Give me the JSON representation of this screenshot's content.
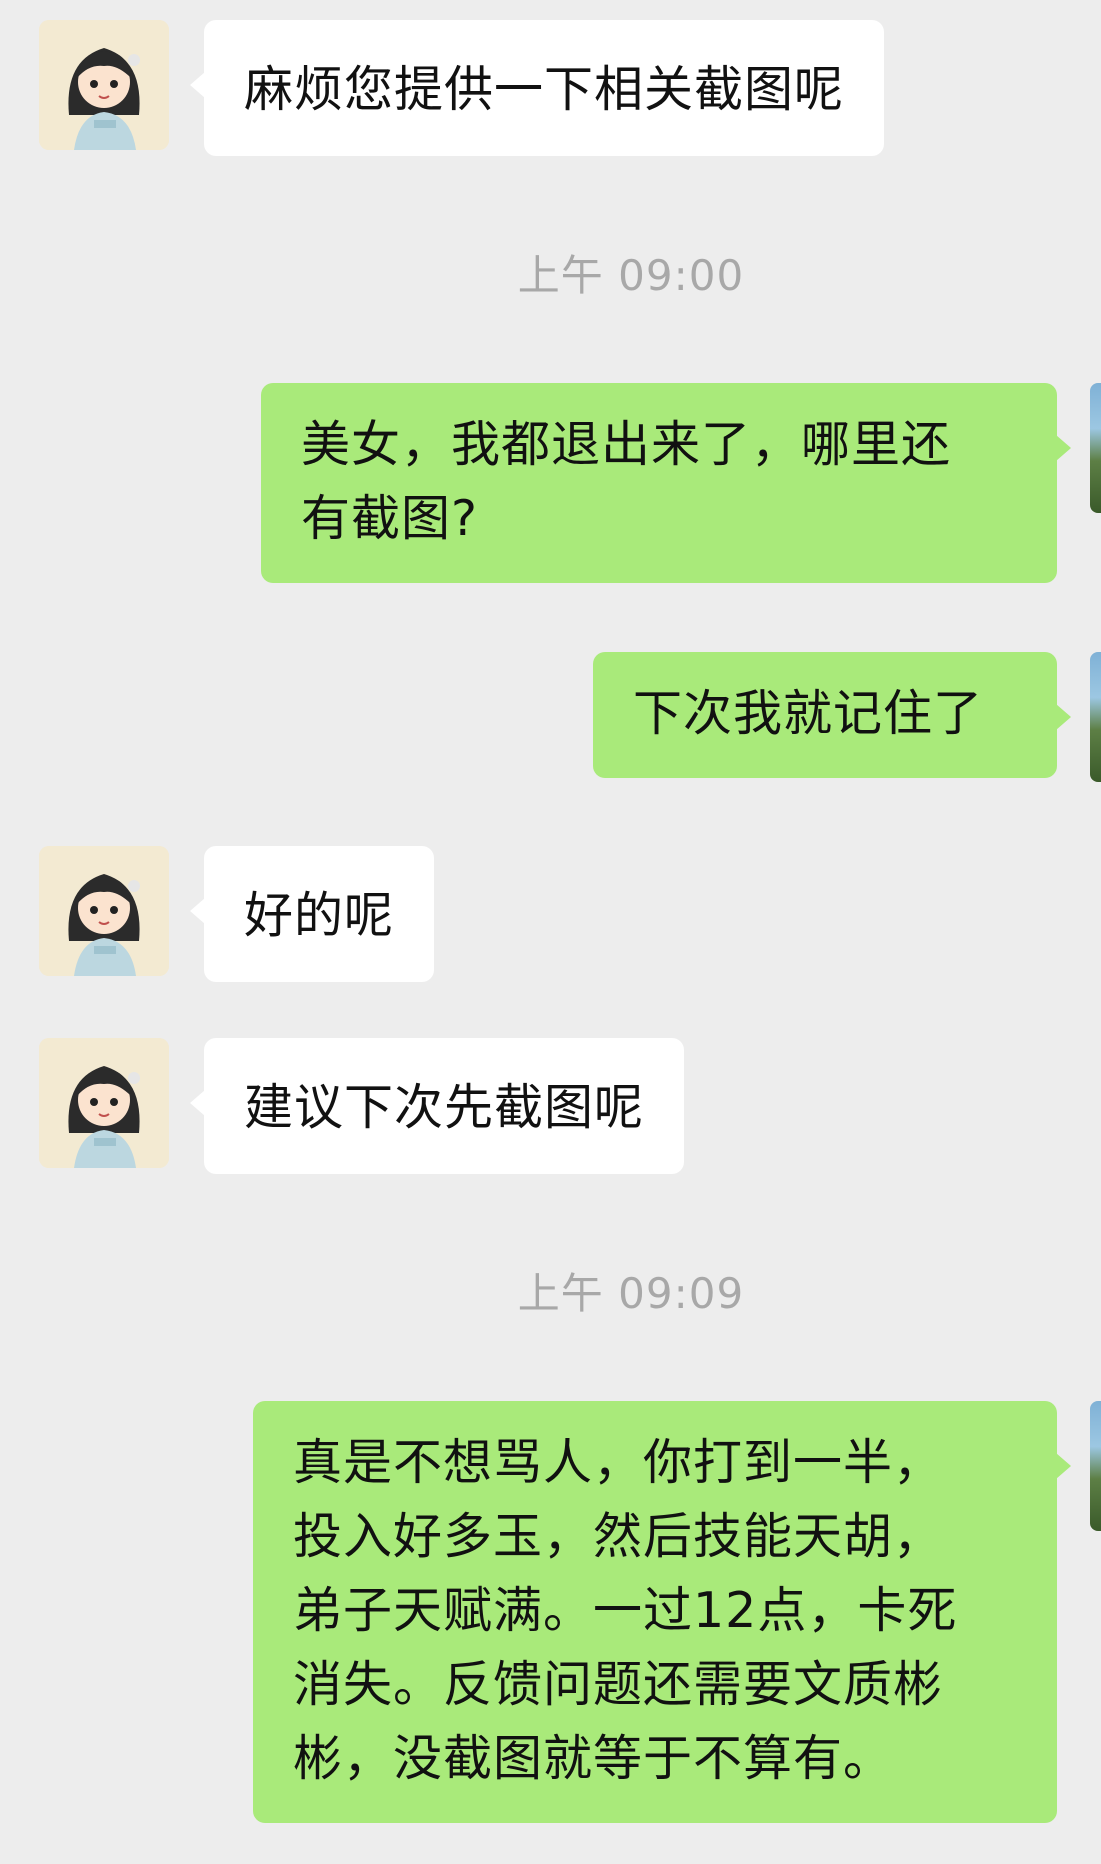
{
  "messages": [
    {
      "side": "in",
      "text": "麻烦您提供一下相关截图呢"
    },
    {
      "side": "out",
      "text": "美女，我都退出来了，哪里还\n有截图?"
    },
    {
      "side": "out",
      "text": "下次我就记住了"
    },
    {
      "side": "in",
      "text": "好的呢"
    },
    {
      "side": "in",
      "text": "建议下次先截图呢"
    },
    {
      "side": "out",
      "text": "真是不想骂人，你打到一半，\n投入好多玉，然后技能天胡，\n弟子天赋满。一过12点，卡死\n消失。反馈问题还需要文质彬\n彬，没截图就等于不算有。"
    }
  ],
  "timestamps": [
    "上午 09:00",
    "上午 09:09"
  ],
  "colors": {
    "background": "#ededed",
    "incoming_bubble": "#ffffff",
    "outgoing_bubble": "#a9ea7a",
    "timestamp_text": "#a8a8a8"
  },
  "icons": {
    "contact_avatar": "anime-girl-avatar",
    "self_avatar": "landscape-avatar"
  }
}
